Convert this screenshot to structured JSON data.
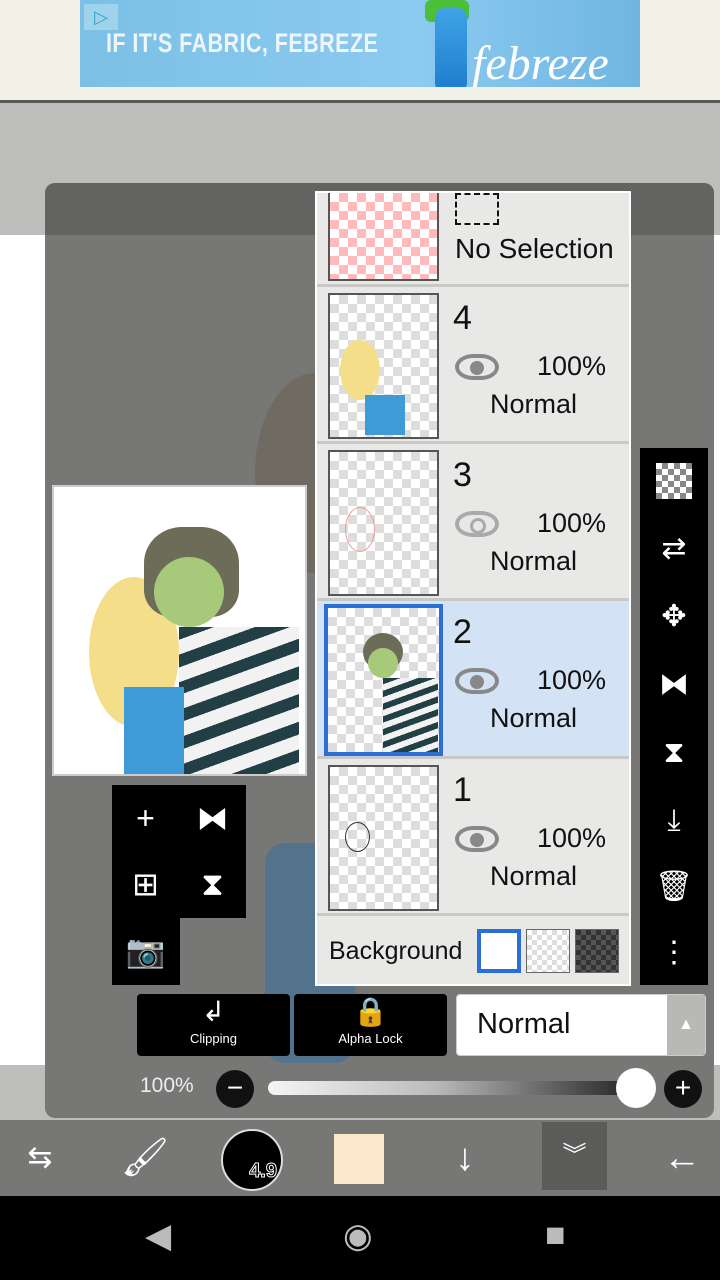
{
  "ad": {
    "slogan": "IF IT'S FABRIC, FEBREZE",
    "brand": "febreze",
    "icon": "ad-choices-play-icon"
  },
  "layers_panel": {
    "selection_layer": {
      "label": "No Selection"
    },
    "layers": [
      {
        "number": "4",
        "visible": true,
        "opacity": "100%",
        "blend": "Normal",
        "selected": false
      },
      {
        "number": "3",
        "visible": true,
        "opacity": "100%",
        "blend": "Normal",
        "selected": false
      },
      {
        "number": "2",
        "visible": true,
        "opacity": "100%",
        "blend": "Normal",
        "selected": true
      },
      {
        "number": "1",
        "visible": true,
        "opacity": "100%",
        "blend": "Normal",
        "selected": false
      }
    ],
    "background": {
      "label": "Background",
      "options": [
        "white",
        "transparent",
        "dark-checker"
      ],
      "selected": "white"
    }
  },
  "right_toolbar": [
    "checker-icon",
    "move-layer-icon",
    "move-icon",
    "flip-horizontal-icon",
    "flip-vertical-icon",
    "merge-down-icon",
    "trash-icon",
    "more-icon"
  ],
  "left_toolbar": [
    "add-layer-icon",
    "flip-icon",
    "add-copy-icon",
    "flip-vertical-icon",
    "camera-icon"
  ],
  "controls": {
    "clipping": "Clipping",
    "alpha_lock": "Alpha Lock",
    "blend_mode": "Normal",
    "opacity_label": "100%",
    "opacity_value": 100
  },
  "bottom_toolbar": {
    "brush_size": "4.9",
    "color": "#fde8cc"
  },
  "colors": {
    "accent": "#2a6fd6",
    "selected_row": "#d3e2f4"
  }
}
